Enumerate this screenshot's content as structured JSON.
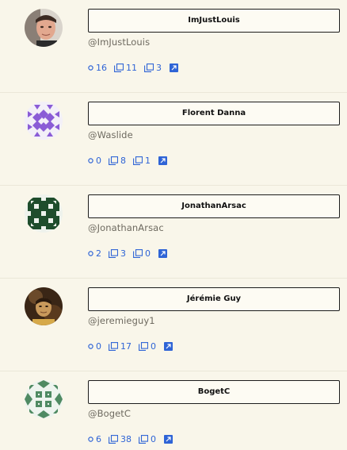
{
  "users": [
    {
      "name": "ImJustLouis",
      "handle": "@ImJustLouis",
      "followers": "16",
      "repos": "11",
      "gists": "3",
      "avatar": "photo-louis"
    },
    {
      "name": "Florent Danna",
      "handle": "@Waslide",
      "followers": "0",
      "repos": "8",
      "gists": "1",
      "avatar": "identicon-purple"
    },
    {
      "name": "JonathanArsac",
      "handle": "@JonathanArsac",
      "followers": "2",
      "repos": "3",
      "gists": "0",
      "avatar": "identicon-darkgreen"
    },
    {
      "name": "Jérémie Guy",
      "handle": "@jeremieguy1",
      "followers": "0",
      "repos": "17",
      "gists": "0",
      "avatar": "photo-jeremie"
    },
    {
      "name": "BogetC",
      "handle": "@BogetC",
      "followers": "6",
      "repos": "38",
      "gists": "0",
      "avatar": "identicon-green"
    }
  ],
  "colors": {
    "accent": "#2f64d6",
    "background": "#f9f6ea",
    "purple": "#8a5cd6",
    "darkgreen": "#1f4d2c",
    "green": "#4f8a63"
  }
}
